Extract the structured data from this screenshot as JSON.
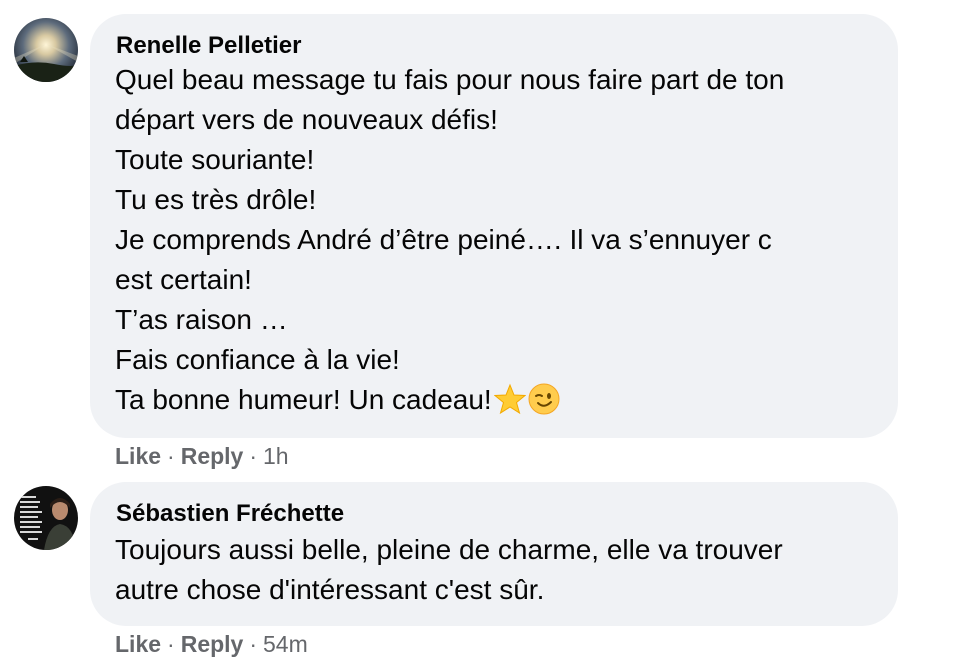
{
  "comments": [
    {
      "author": "Renelle Pelletier",
      "lines": [
        "Quel beau message tu fais pour nous faire part de ton",
        "départ vers de nouveaux défis!",
        "Toute souriante!",
        "Tu es très drôle!",
        "Je comprends André d’être peiné…. Il va s’ennuyer c",
        "est certain!",
        "T’as raison …",
        "Fais confiance à la vie!",
        "Ta bonne humeur! Un cadeau!"
      ],
      "emojis": [
        "star-emoji",
        "winking-face-emoji"
      ],
      "like_label": "Like",
      "reply_label": "Reply",
      "separator": "·",
      "time": "1h",
      "avatar": "sunset-sky-avatar"
    },
    {
      "author": "Sébastien Fréchette",
      "lines": [
        "Toujours aussi belle, pleine de charme, elle va trouver",
        "autre chose d'intéressant c'est sûr."
      ],
      "like_label": "Like",
      "reply_label": "Reply",
      "separator": "·",
      "time": "54m",
      "avatar": "quote-poster-avatar"
    }
  ],
  "colors": {
    "bubble_bg": "#f0f2f5",
    "text": "#050505",
    "secondary_text": "#65676b"
  }
}
